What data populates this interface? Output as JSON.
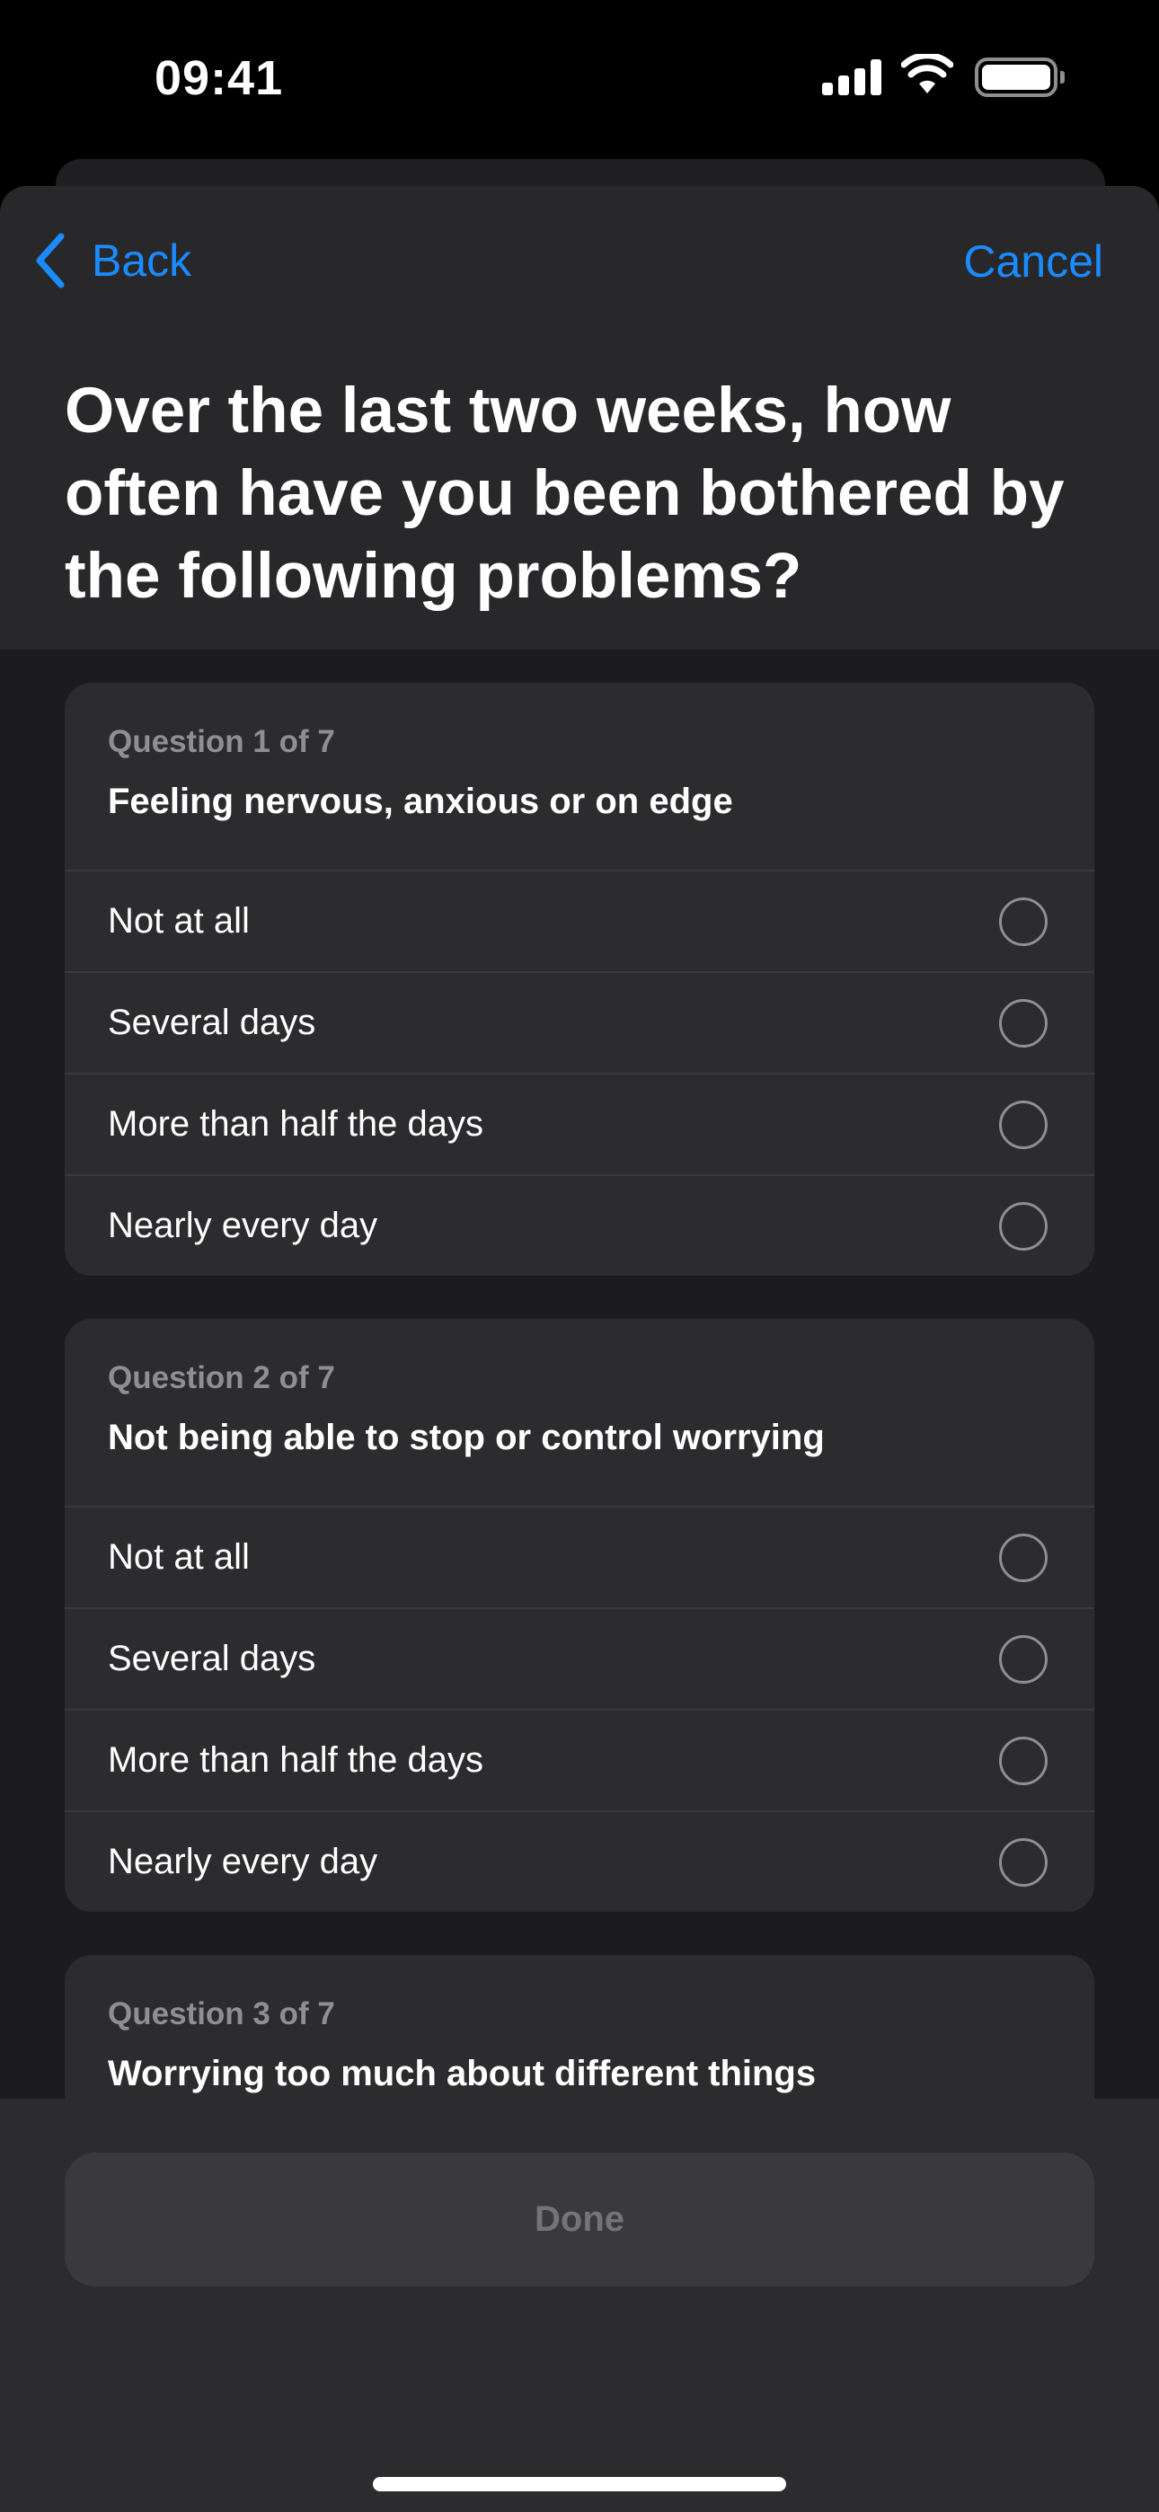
{
  "status_bar": {
    "time": "09:41",
    "signal_icon": "cellular-signal-icon",
    "wifi_icon": "wifi-icon",
    "battery_icon": "battery-icon"
  },
  "nav": {
    "back_label": "Back",
    "cancel_label": "Cancel",
    "accent_color": "#1a8cff"
  },
  "title": "Over the last two weeks, how often have you been bothered by the following problems?",
  "questions": [
    {
      "label": "Question 1 of 7",
      "text": "Feeling nervous, anxious or on edge",
      "options": [
        "Not at all",
        "Several days",
        "More than half the days",
        "Nearly every day"
      ]
    },
    {
      "label": "Question 2 of 7",
      "text": "Not being able to stop or control worrying",
      "options": [
        "Not at all",
        "Several days",
        "More than half the days",
        "Nearly every day"
      ]
    },
    {
      "label": "Question 3 of 7",
      "text": "Worrying too much about different things"
    }
  ],
  "done_label": "Done"
}
